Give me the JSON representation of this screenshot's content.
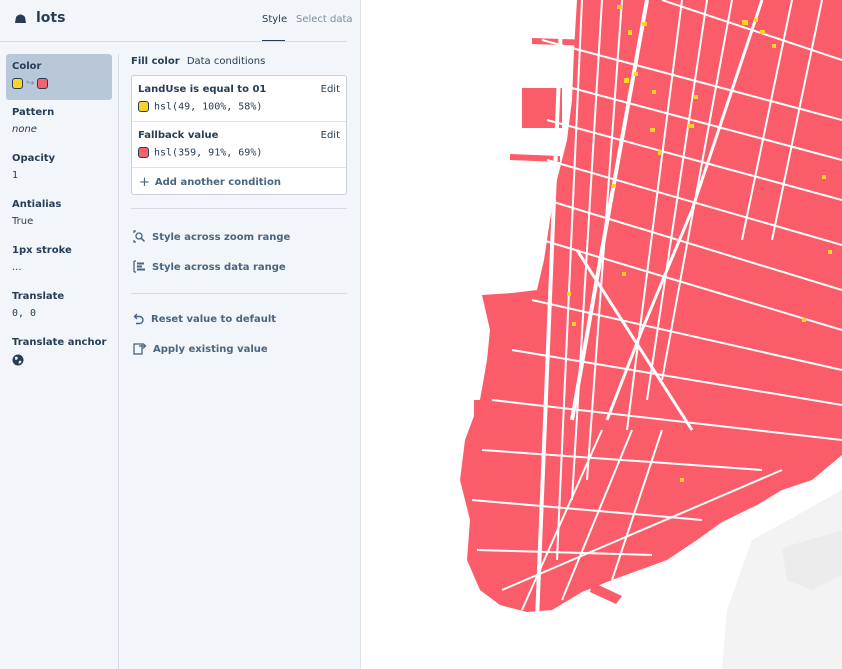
{
  "layer": {
    "name": "lots",
    "icon": "fill-layer-icon"
  },
  "header_tabs": {
    "style": "Style",
    "select_data": "Select data"
  },
  "properties": [
    {
      "label": "Color",
      "value": "",
      "selected": true
    },
    {
      "label": "Pattern",
      "value": "none"
    },
    {
      "label": "Opacity",
      "value": "1"
    },
    {
      "label": "Antialias",
      "value": "True"
    },
    {
      "label": "1px stroke",
      "value": "..."
    },
    {
      "label": "Translate",
      "value": "0, 0"
    },
    {
      "label": "Translate anchor",
      "value": "",
      "icon": "globe-icon"
    }
  ],
  "editor": {
    "tab_fill": "Fill color",
    "tab_conditions": "Data conditions",
    "conditions": [
      {
        "title": "LandUse is equal to 01",
        "edit": "Edit",
        "value": "hsl(49, 100%, 58%)",
        "color": "#fdd22a"
      },
      {
        "title": "Fallback value",
        "edit": "Edit",
        "value": "hsl(359, 91%, 69%)",
        "color": "#f6636a"
      }
    ],
    "add_condition": "Add another condition",
    "zoom_range": "Style across zoom range",
    "data_range": "Style across data range",
    "reset": "Reset value to default",
    "apply_existing": "Apply existing value"
  },
  "colors": {
    "lot_fill": "#fa5c6a",
    "landuse_01": "#fdd22a",
    "panel_bg": "#f2f5f9",
    "selected_bg": "#b8c8d8"
  }
}
